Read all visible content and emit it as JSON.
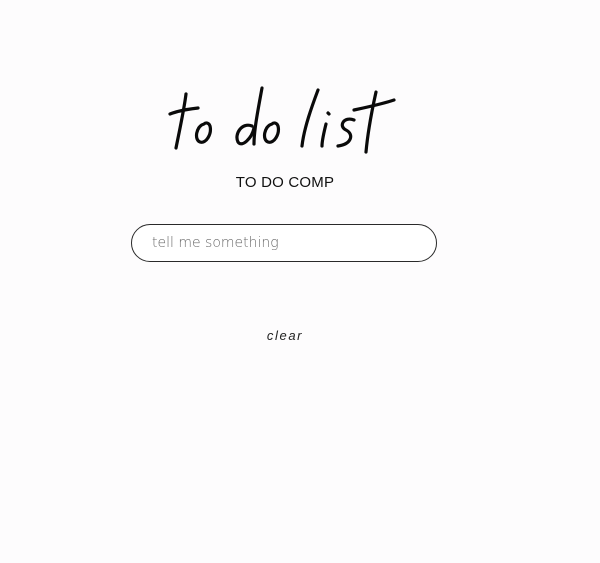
{
  "header": {
    "title": "to do list",
    "subtitle": "TO DO COMP"
  },
  "input": {
    "placeholder": "tell me something",
    "value": ""
  },
  "actions": {
    "clear_label": "clear"
  },
  "todos": [],
  "colors": {
    "background": "#fdfcfd",
    "text": "#111111",
    "border": "#2a2a2a"
  }
}
